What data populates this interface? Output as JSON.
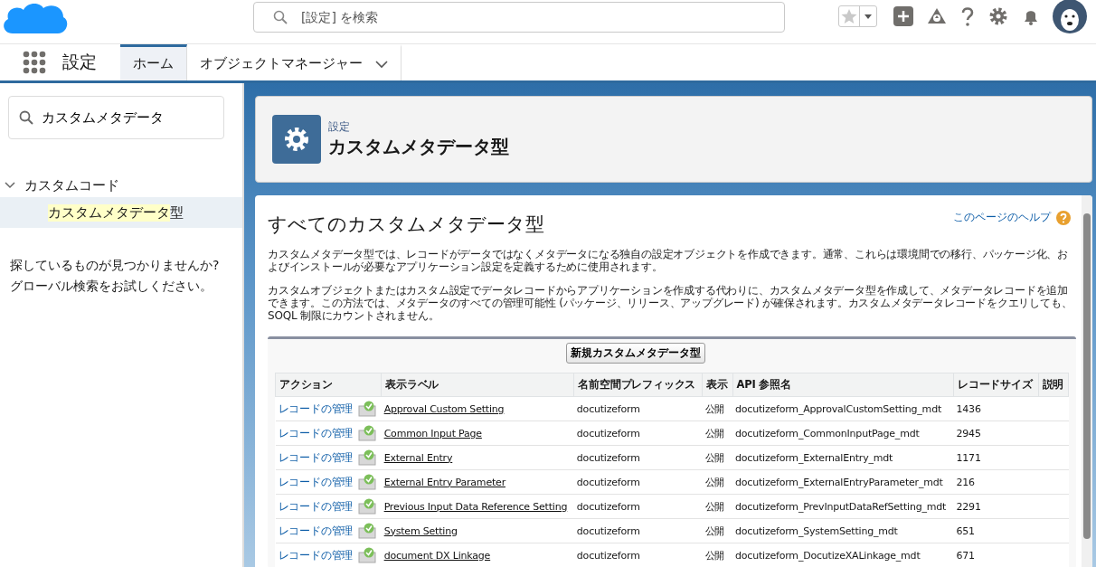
{
  "header": {
    "search": {
      "placeholder": "[設定] を検索"
    }
  },
  "nav": {
    "app_name": "設定",
    "tabs": [
      {
        "label": "ホーム",
        "selected": true,
        "dropdown": false
      },
      {
        "label": "オブジェクトマネージャー",
        "selected": false,
        "dropdown": true
      }
    ]
  },
  "sidebar": {
    "search": {
      "value": "カスタムメタデータ"
    },
    "tree": [
      {
        "label": "カスタムコード",
        "expanded": true,
        "children": [
          {
            "match": "カスタムメタデータ",
            "rest": "型",
            "selected": true
          }
        ]
      }
    ],
    "not_found": [
      "探しているものが見つかりませんか?",
      "グローバル検索をお試しください。"
    ]
  },
  "page_header": {
    "breadcrumb": "設定",
    "title": "カスタムメタデータ型"
  },
  "content": {
    "title": "すべてのカスタムメタデータ型",
    "help_link": "このページのヘルプ",
    "paragraphs": [
      "カスタムメタデータ型では、レコードがデータではなくメタデータになる独自の設定オブジェクトを作成できます。通常、これらは環境間での移行、パッケージ化、およびインストールが必要なアプリケーション設定を定義するために使用されます。",
      "カスタムオブジェクトまたはカスタム設定でデータレコードからアプリケーションを作成する代わりに、カスタムメタデータ型を作成して、メタデータレコードを追加できます。この方法では、メタデータのすべての管理可能性 (パッケージ、リリース、アップグレード) が確保されます。カスタムメタデータレコードをクエリしても、SOQL 制限にカウントされません。"
    ],
    "new_button": "新規カスタムメタデータ型",
    "table": {
      "columns": [
        "アクション",
        "表示ラベル",
        "名前空間プレフィックス",
        "表示",
        "API 参照名",
        "レコードサイズ",
        "説明"
      ],
      "rows": [
        {
          "action": "レコードの管理",
          "label": "Approval Custom Setting",
          "namespace": "docutizeform",
          "visibility": "公開",
          "api_name": "docutizeform_ApprovalCustomSetting_mdt",
          "record_size": "1436"
        },
        {
          "action": "レコードの管理",
          "label": "Common Input Page",
          "namespace": "docutizeform",
          "visibility": "公開",
          "api_name": "docutizeform_CommonInputPage_mdt",
          "record_size": "2945"
        },
        {
          "action": "レコードの管理",
          "label": "External Entry",
          "namespace": "docutizeform",
          "visibility": "公開",
          "api_name": "docutizeform_ExternalEntry_mdt",
          "record_size": "1171"
        },
        {
          "action": "レコードの管理",
          "label": "External Entry Parameter",
          "namespace": "docutizeform",
          "visibility": "公開",
          "api_name": "docutizeform_ExternalEntryParameter_mdt",
          "record_size": "216"
        },
        {
          "action": "レコードの管理",
          "label": "Previous Input Data Reference Setting",
          "namespace": "docutizeform",
          "visibility": "公開",
          "api_name": "docutizeform_PrevInputDataRefSetting_mdt",
          "record_size": "2291"
        },
        {
          "action": "レコードの管理",
          "label": "System Setting",
          "namespace": "docutizeform",
          "visibility": "公開",
          "api_name": "docutizeform_SystemSetting_mdt",
          "record_size": "651"
        },
        {
          "action": "レコードの管理",
          "label": "document DX Linkage",
          "namespace": "docutizeform",
          "visibility": "公開",
          "api_name": "docutizeform_DocutizeXALinkage_mdt",
          "record_size": "671"
        }
      ]
    }
  }
}
